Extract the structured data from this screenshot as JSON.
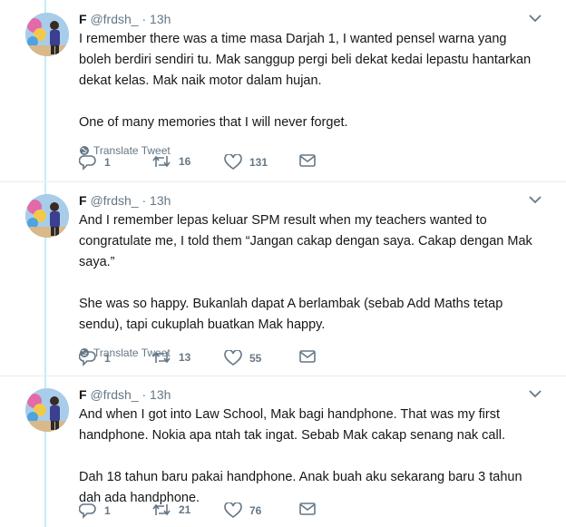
{
  "tweets": [
    {
      "name": "F",
      "handle": "@frdsh_",
      "dot": "·",
      "time": "13h",
      "paragraphs": [
        "I remember there was a time masa Darjah 1, I wanted pensel warna yang boleh berdiri sendiri tu. Mak sanggup pergi beli dekat kedai lepastu hantarkan dekat kelas. Mak naik motor dalam hujan.",
        "One of many memories that I will never forget."
      ],
      "translate": "Translate Tweet",
      "replies": "1",
      "retweets": "16",
      "likes": "131"
    },
    {
      "name": "F",
      "handle": "@frdsh_",
      "dot": "·",
      "time": "13h",
      "paragraphs": [
        "And I remember lepas keluar SPM result when my teachers wanted to congratulate me, I told them “Jangan cakap dengan saya. Cakap dengan Mak saya.”",
        "She was so happy. Bukanlah dapat A berlambak (sebab Add Maths tetap sendu), tapi cukuplah buatkan Mak happy."
      ],
      "translate": "Translate Tweet",
      "replies": "1",
      "retweets": "13",
      "likes": "55"
    },
    {
      "name": "F",
      "handle": "@frdsh_",
      "dot": "·",
      "time": "13h",
      "paragraphs": [
        "And when I got into Law School, Mak bagi handphone. That was my first handphone. Nokia apa ntah tak ingat. Sebab Mak cakap senang nak call.",
        "Dah 18 tahun baru pakai handphone. Anak buah aku sekarang baru 3 tahun dah ada handphone."
      ],
      "replies": "1",
      "retweets": "21",
      "likes": "76"
    }
  ],
  "colors": {
    "accent": "#1da1f2",
    "thread_line": "#c4eefa",
    "muted": "#657786",
    "text": "#14171a"
  },
  "icons": [
    "globe-icon",
    "reply-icon",
    "retweet-icon",
    "like-icon",
    "dm-icon",
    "chevron-down-icon"
  ]
}
